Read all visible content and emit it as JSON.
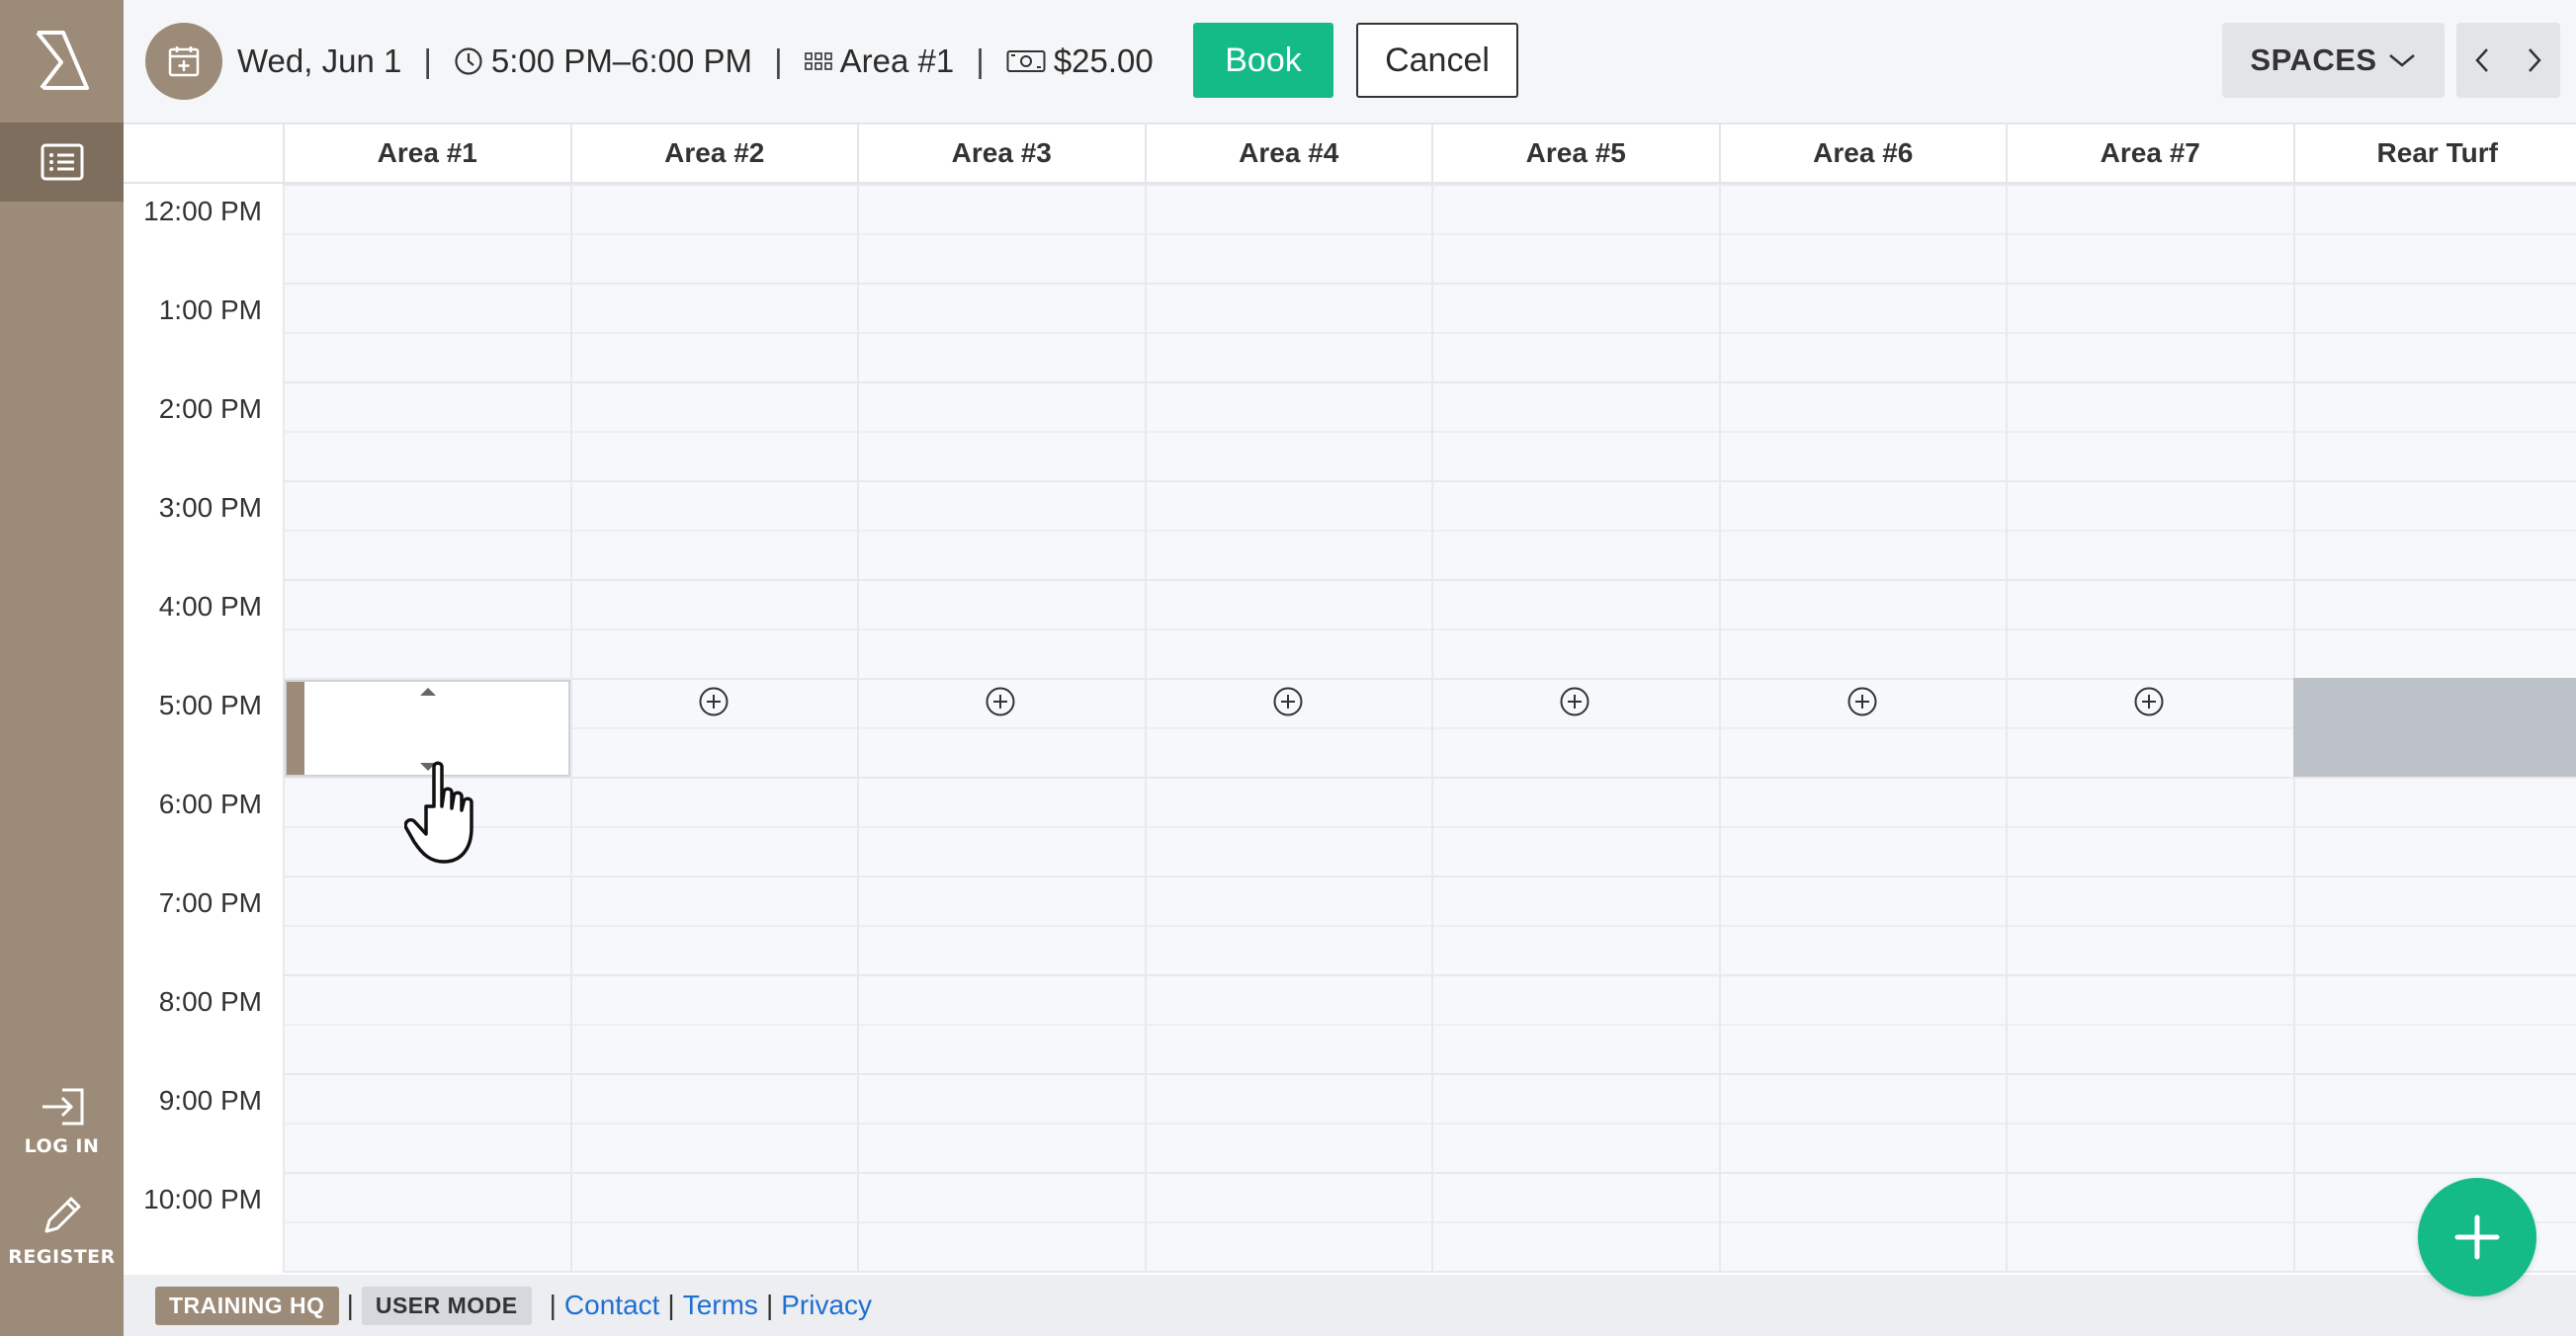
{
  "booking": {
    "date": "Wed, Jun 1",
    "time_range": "5:00 PM–6:00 PM",
    "area": "Area #1",
    "price": "$25.00",
    "book_label": "Book",
    "cancel_label": "Cancel",
    "separator": "|"
  },
  "nav": {
    "spaces_label": "SPACES"
  },
  "sidebar": {
    "login_label": "LOG IN",
    "register_label": "REGISTER"
  },
  "columns": [
    "Area #1",
    "Area #2",
    "Area #3",
    "Area #4",
    "Area #5",
    "Area #6",
    "Area #7",
    "Rear Turf"
  ],
  "times": [
    "12:00 PM",
    "1:00 PM",
    "2:00 PM",
    "3:00 PM",
    "4:00 PM",
    "5:00 PM",
    "6:00 PM",
    "7:00 PM",
    "8:00 PM",
    "9:00 PM",
    "10:00 PM"
  ],
  "footer": {
    "org_label": "TRAINING HQ",
    "mode_label": "USER MODE",
    "contact_label": "Contact",
    "terms_label": "Terms",
    "privacy_label": "Privacy",
    "separator": "|"
  },
  "colors": {
    "brand": "#9c8b78",
    "accent_green": "#14bb86",
    "link": "#1f6fd1",
    "unavailable": "#bdc2c8"
  },
  "icons": [
    "app-logo-icon",
    "list-icon",
    "login-icon",
    "pencil-icon",
    "calendar-add-icon",
    "clock-icon",
    "grid-icon",
    "cash-icon",
    "chevron-down-icon",
    "chevron-left-icon",
    "chevron-right-icon",
    "add-circle-icon",
    "plus-icon"
  ]
}
